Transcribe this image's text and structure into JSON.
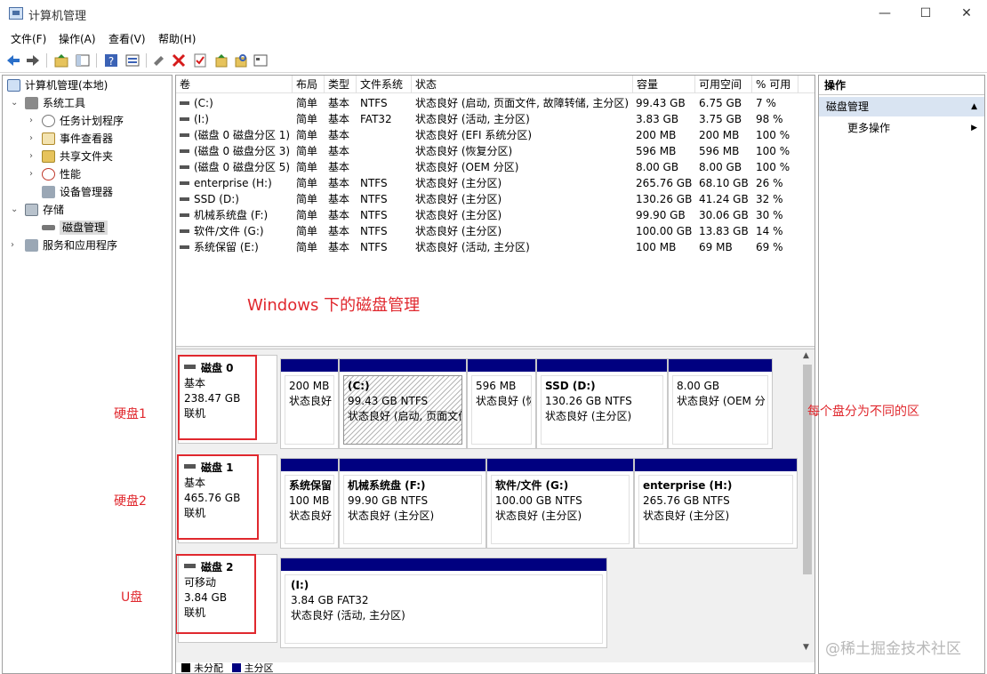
{
  "window": {
    "title": "计算机管理",
    "minimize": "—",
    "maximize": "☐",
    "close": "✕"
  },
  "menu": [
    "文件(F)",
    "操作(A)",
    "查看(V)",
    "帮助(H)"
  ],
  "toolbar_icons": [
    "back-icon",
    "forward-icon",
    "up-folder-icon",
    "show-hide-tree-icon",
    "help-icon",
    "properties-icon",
    "connect-icon",
    "delete-icon",
    "check-icon",
    "export-icon",
    "search-icon",
    "console-icon"
  ],
  "tree": {
    "root": "计算机管理(本地)",
    "system_tools": "系统工具",
    "task_scheduler": "任务计划程序",
    "event_viewer": "事件查看器",
    "shared_folders": "共享文件夹",
    "performance": "性能",
    "device_manager": "设备管理器",
    "storage": "存储",
    "disk_management": "磁盘管理",
    "services_apps": "服务和应用程序"
  },
  "volume_table": {
    "headers": [
      "卷",
      "布局",
      "类型",
      "文件系统",
      "状态",
      "容量",
      "可用空间",
      "% 可用"
    ],
    "rows": [
      [
        "(C:)",
        "简单",
        "基本",
        "NTFS",
        "状态良好 (启动, 页面文件, 故障转储, 主分区)",
        "99.43 GB",
        "6.75 GB",
        "7 %"
      ],
      [
        "(I:)",
        "简单",
        "基本",
        "FAT32",
        "状态良好 (活动, 主分区)",
        "3.83 GB",
        "3.75 GB",
        "98 %"
      ],
      [
        "(磁盘 0 磁盘分区 1)",
        "简单",
        "基本",
        "",
        "状态良好 (EFI 系统分区)",
        "200 MB",
        "200 MB",
        "100 %"
      ],
      [
        "(磁盘 0 磁盘分区 3)",
        "简单",
        "基本",
        "",
        "状态良好 (恢复分区)",
        "596 MB",
        "596 MB",
        "100 %"
      ],
      [
        "(磁盘 0 磁盘分区 5)",
        "简单",
        "基本",
        "",
        "状态良好 (OEM 分区)",
        "8.00 GB",
        "8.00 GB",
        "100 %"
      ],
      [
        "enterprise (H:)",
        "简单",
        "基本",
        "NTFS",
        "状态良好 (主分区)",
        "265.76 GB",
        "68.10 GB",
        "26 %"
      ],
      [
        "SSD (D:)",
        "简单",
        "基本",
        "NTFS",
        "状态良好 (主分区)",
        "130.26 GB",
        "41.24 GB",
        "32 %"
      ],
      [
        "机械系统盘 (F:)",
        "简单",
        "基本",
        "NTFS",
        "状态良好 (主分区)",
        "99.90 GB",
        "30.06 GB",
        "30 %"
      ],
      [
        "软件/文件 (G:)",
        "简单",
        "基本",
        "NTFS",
        "状态良好 (主分区)",
        "100.00 GB",
        "13.83 GB",
        "14 %"
      ],
      [
        "系统保留 (E:)",
        "简单",
        "基本",
        "NTFS",
        "状态良好 (活动, 主分区)",
        "100 MB",
        "69 MB",
        "69 %"
      ]
    ]
  },
  "annotations": {
    "center_note": "Windows 下的磁盘管理",
    "disk0_note": "硬盘1",
    "disk1_note": "硬盘2",
    "disk2_note": "U盘",
    "partitions_note": "每个盘分为不同的区"
  },
  "disks": {
    "disk0": {
      "name": "磁盘 0",
      "type": "基本",
      "size": "238.47 GB",
      "status": "联机"
    },
    "disk1": {
      "name": "磁盘 1",
      "type": "基本",
      "size": "465.76 GB",
      "status": "联机"
    },
    "disk2": {
      "name": "磁盘 2",
      "type": "可移动",
      "size": "3.84 GB",
      "status": "联机"
    }
  },
  "partitions": {
    "d0p1": {
      "name": "",
      "size": "200 MB",
      "status": "状态良好"
    },
    "d0p2": {
      "name": "(C:)",
      "size": "99.43 GB NTFS",
      "status": "状态良好 (启动, 页面文件"
    },
    "d0p3": {
      "name": "",
      "size": "596 MB",
      "status": "状态良好 (恢"
    },
    "d0p4": {
      "name": "SSD   (D:)",
      "size": "130.26 GB NTFS",
      "status": "状态良好 (主分区)"
    },
    "d0p5": {
      "name": "",
      "size": "8.00 GB",
      "status": "状态良好 (OEM 分"
    },
    "d1p1": {
      "name": "系统保留",
      "size": "100 MB",
      "status": "状态良好"
    },
    "d1p2": {
      "name": "机械系统盘  (F:)",
      "size": "99.90 GB NTFS",
      "status": "状态良好 (主分区)"
    },
    "d1p3": {
      "name": "软件/文件  (G:)",
      "size": "100.00 GB NTFS",
      "status": "状态良好 (主分区)"
    },
    "d1p4": {
      "name": "enterprise  (H:)",
      "size": "265.76 GB NTFS",
      "status": "状态良好 (主分区)"
    },
    "d2p1": {
      "name": "(I:)",
      "size": "3.84 GB FAT32",
      "status": "状态良好 (活动, 主分区)"
    }
  },
  "legend": {
    "unallocated": "未分配",
    "primary": "主分区"
  },
  "actions": {
    "title": "操作",
    "selected": "磁盘管理",
    "more": "更多操作"
  },
  "watermark": "@稀土掘金技术社区",
  "colors": {
    "partition_bar": "#000080",
    "annotation": "#e0282e"
  }
}
